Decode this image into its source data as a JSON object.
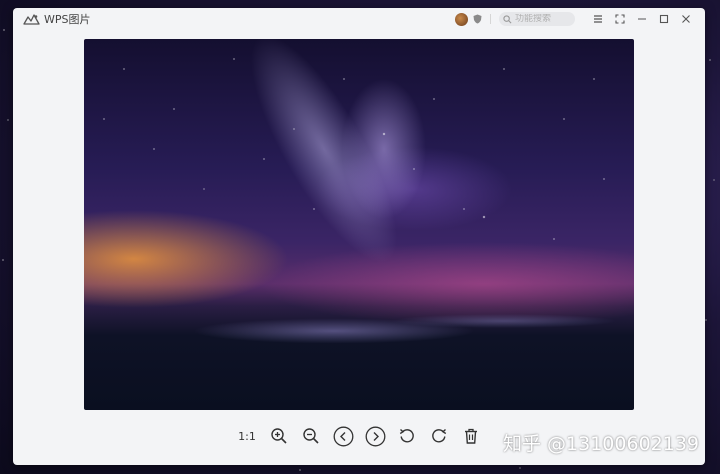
{
  "window": {
    "title": "WPS图片",
    "search_placeholder": "功能搜索"
  },
  "toolbar": {
    "actual_size_label": "1:1"
  },
  "watermark": {
    "text": "知乎 @13100602139"
  },
  "icons": {
    "app_logo": "wps-photo-logo-icon",
    "avatar": "user-avatar",
    "badge": "shield-icon",
    "search": "search-icon",
    "menu": "menu-icon",
    "fullscreen": "fullscreen-icon",
    "minimize": "minimize-icon",
    "maximize": "maximize-icon",
    "close": "close-icon",
    "zoom_in": "zoom-in-icon",
    "zoom_out": "zoom-out-icon",
    "previous": "chevron-left-icon",
    "next": "chevron-right-icon",
    "rotate_left": "rotate-left-icon",
    "rotate_right": "rotate-right-icon",
    "delete": "trash-icon"
  },
  "colors": {
    "window_bg": "#f3f4f6",
    "icon": "#333333"
  }
}
